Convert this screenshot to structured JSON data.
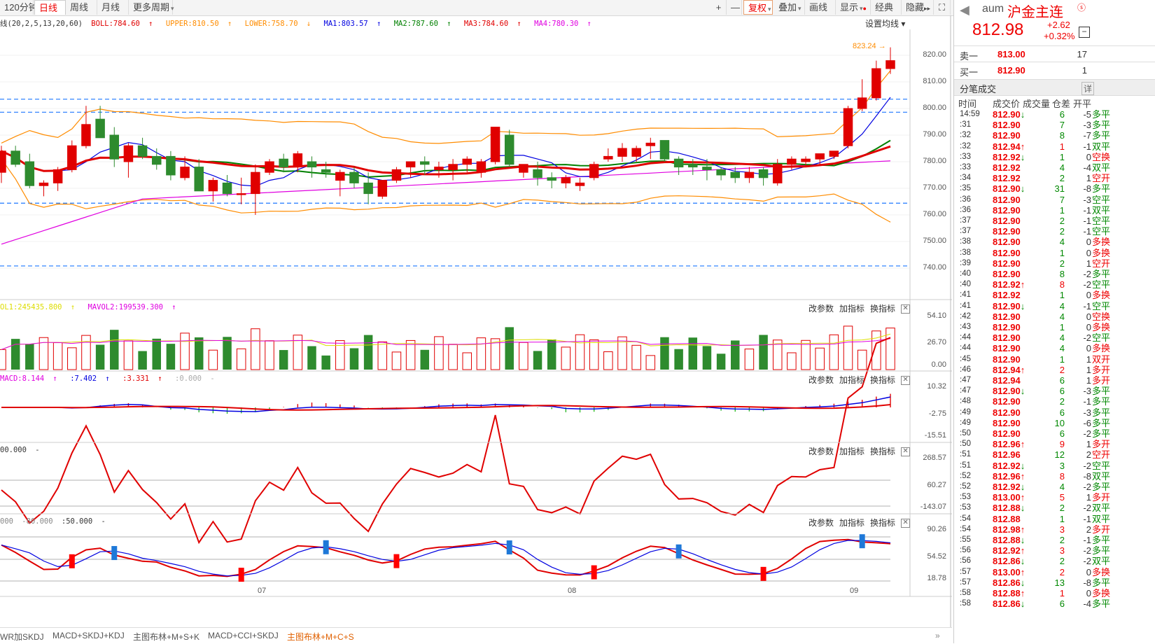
{
  "toolbar": {
    "period_tabs": [
      "120分钟",
      "日线",
      "周线",
      "月线",
      "更多周期"
    ],
    "active_period": "日线",
    "right_buttons": [
      "+",
      "—",
      "复权",
      "叠加",
      "画线",
      "显示",
      "经典",
      "隐藏",
      "⛶"
    ]
  },
  "main_legend": {
    "prefix": "线(20,2,5,13,20,60)",
    "items": [
      {
        "text": "BOLL:784.60",
        "arrow": "↑",
        "color": "#e00000"
      },
      {
        "text": "UPPER:810.50",
        "arrow": "↑",
        "color": "#ff8c00"
      },
      {
        "text": "LOWER:758.70",
        "arrow": "↓",
        "color": "#ff8c00"
      },
      {
        "text": "MA1:803.57",
        "arrow": "↑",
        "color": "#0000e0"
      },
      {
        "text": "MA2:787.60",
        "arrow": "↑",
        "color": "#008000"
      },
      {
        "text": "MA3:784.60",
        "arrow": "↑",
        "color": "#e00000"
      },
      {
        "text": "MA4:780.30",
        "arrow": "↑",
        "color": "#e000e0"
      }
    ],
    "ma_setting": "设置均线 ▾"
  },
  "main_axis": [
    "820.00",
    "810.00",
    "800.00",
    "790.00",
    "780.00",
    "770.00",
    "760.00",
    "750.00",
    "740.00"
  ],
  "peak_label": "823.24",
  "vol_legend": [
    {
      "text": "OL1:245435.800",
      "arrow": "↑",
      "color": "#dddd00"
    },
    {
      "text": "MAVOL2:199539.300",
      "arrow": "↑",
      "color": "#e000e0"
    }
  ],
  "vol_axis": [
    "54.10",
    "26.70",
    "0.00"
  ],
  "macd_legend": [
    {
      "text": "MACD:8.144",
      "arrow": "↑",
      "color": "#e000e0"
    },
    {
      "text": ":7.402",
      "arrow": "↑",
      "color": "#0000e0"
    },
    {
      "text": ":3.331",
      "arrow": "↑",
      "color": "#e00000"
    },
    {
      "text": ":0.000",
      "arrow": "-",
      "color": "#aaaaaa"
    }
  ],
  "macd_axis": [
    "10.32",
    "-2.75",
    "-15.51"
  ],
  "cci_legend": [
    {
      "text": "00.000",
      "arrow": "-",
      "color": "#333333"
    }
  ],
  "cci_axis": [
    "268.57",
    "60.27",
    "-143.07"
  ],
  "kdj_legend": [
    {
      "text": "000",
      "arrow": "",
      "color": "#888888"
    },
    {
      "text": "-80.000",
      "arrow": "",
      "color": "#888888"
    },
    {
      "text": ":50.000",
      "arrow": "-",
      "color": "#333333"
    }
  ],
  "kdj_axis": [
    "90.26",
    "54.52",
    "18.78"
  ],
  "panel_buttons": [
    "改参数",
    "加指标",
    "换指标"
  ],
  "x_labels": [
    "07",
    "08",
    "09"
  ],
  "bottom_tabs": [
    "WR加SKDJ",
    "MACD+SKDJ+KDJ",
    "主图布林+M+S+K",
    "MACD+CCI+SKDJ",
    "主图布林+M+C+S"
  ],
  "active_bottom_tab": "主图布林+M+C+S",
  "quote": {
    "code": "aum",
    "name": "沪金主连",
    "price": "812.98",
    "change": "+2.62",
    "change_pct": "+0.32%",
    "sell1_label": "卖一",
    "sell1_price": "813.00",
    "sell1_vol": "17",
    "buy1_label": "买一",
    "buy1_price": "812.90",
    "buy1_vol": "1"
  },
  "ticks_title": "分笔成交",
  "ticks_detail": "详",
  "ticks_headers": [
    "时间",
    "成交价",
    "成交量",
    "仓差",
    "开平"
  ],
  "ticks": [
    [
      "14:59",
      "812.90",
      "↓",
      "6",
      "-5",
      "多平"
    ],
    [
      ":31",
      "812.90",
      "",
      "7",
      "-3",
      "多平"
    ],
    [
      ":32",
      "812.90",
      "",
      "8",
      "-7",
      "多平"
    ],
    [
      ":32",
      "812.94",
      "↑",
      "1",
      "-1",
      "双平"
    ],
    [
      ":33",
      "812.92",
      "↓",
      "1",
      "0",
      "空换"
    ],
    [
      ":33",
      "812.92",
      "",
      "4",
      "-4",
      "双平"
    ],
    [
      ":34",
      "812.92",
      "",
      "2",
      "1",
      "空开"
    ],
    [
      ":35",
      "812.90",
      "↓",
      "31",
      "-8",
      "多平"
    ],
    [
      ":36",
      "812.90",
      "",
      "7",
      "-3",
      "空平"
    ],
    [
      ":36",
      "812.90",
      "",
      "1",
      "-1",
      "双平"
    ],
    [
      ":37",
      "812.90",
      "",
      "2",
      "-1",
      "空平"
    ],
    [
      ":37",
      "812.90",
      "",
      "2",
      "-1",
      "空平"
    ],
    [
      ":38",
      "812.90",
      "",
      "4",
      "0",
      "多换"
    ],
    [
      ":38",
      "812.90",
      "",
      "1",
      "0",
      "多换"
    ],
    [
      ":39",
      "812.90",
      "",
      "2",
      "1",
      "空开"
    ],
    [
      ":40",
      "812.90",
      "",
      "8",
      "-2",
      "多平"
    ],
    [
      ":40",
      "812.92",
      "↑",
      "8",
      "-2",
      "空平"
    ],
    [
      ":41",
      "812.92",
      "",
      "1",
      "0",
      "多换"
    ],
    [
      ":41",
      "812.90",
      "↓",
      "4",
      "-1",
      "空平"
    ],
    [
      ":42",
      "812.90",
      "",
      "4",
      "0",
      "空换"
    ],
    [
      ":43",
      "812.90",
      "",
      "1",
      "0",
      "多换"
    ],
    [
      ":44",
      "812.90",
      "",
      "4",
      "-2",
      "空平"
    ],
    [
      ":44",
      "812.90",
      "",
      "4",
      "0",
      "多换"
    ],
    [
      ":45",
      "812.90",
      "",
      "1",
      "1",
      "双开"
    ],
    [
      ":46",
      "812.94",
      "↑",
      "2",
      "1",
      "多开"
    ],
    [
      ":47",
      "812.94",
      "",
      "6",
      "1",
      "多开"
    ],
    [
      ":47",
      "812.90",
      "↓",
      "6",
      "-3",
      "多平"
    ],
    [
      ":48",
      "812.90",
      "",
      "2",
      "-1",
      "多平"
    ],
    [
      ":49",
      "812.90",
      "",
      "6",
      "-3",
      "多平"
    ],
    [
      ":49",
      "812.90",
      "",
      "10",
      "-6",
      "多平"
    ],
    [
      ":50",
      "812.90",
      "",
      "6",
      "-2",
      "多平"
    ],
    [
      ":50",
      "812.96",
      "↑",
      "9",
      "1",
      "多开"
    ],
    [
      ":51",
      "812.96",
      "",
      "12",
      "2",
      "空开"
    ],
    [
      ":51",
      "812.92",
      "↓",
      "3",
      "-2",
      "空平"
    ],
    [
      ":52",
      "812.96",
      "↑",
      "8",
      "-8",
      "双平"
    ],
    [
      ":52",
      "812.92",
      "↓",
      "4",
      "-2",
      "多平"
    ],
    [
      ":53",
      "813.00",
      "↑",
      "5",
      "1",
      "多开"
    ],
    [
      ":53",
      "812.88",
      "↓",
      "2",
      "-2",
      "双平"
    ],
    [
      ":54",
      "812.88",
      "",
      "1",
      "-1",
      "双平"
    ],
    [
      ":54",
      "812.98",
      "↑",
      "3",
      "2",
      "多开"
    ],
    [
      ":55",
      "812.88",
      "↓",
      "2",
      "-1",
      "多平"
    ],
    [
      ":56",
      "812.92",
      "↑",
      "3",
      "-2",
      "多平"
    ],
    [
      ":56",
      "812.86",
      "↓",
      "2",
      "-2",
      "双平"
    ],
    [
      ":57",
      "813.00",
      "↑",
      "2",
      "0",
      "多换"
    ],
    [
      ":57",
      "812.86",
      "↓",
      "13",
      "-8",
      "多平"
    ],
    [
      ":58",
      "812.88",
      "↑",
      "1",
      "0",
      "多换"
    ],
    [
      ":58",
      "812.86",
      "↓",
      "6",
      "-4",
      "多平"
    ]
  ],
  "colors": {
    "up": "#e00000",
    "down": "#2e8b2e",
    "boll_band": "#ff8c00",
    "ma1": "#0000e0",
    "ma2": "#008000",
    "ma4": "#e000e0",
    "ref_line": "#1e78ff"
  },
  "chart_data": {
    "type": "candlestick",
    "candles": [
      [
        776,
        786,
        772,
        784
      ],
      [
        784,
        786,
        778,
        779
      ],
      [
        780,
        783,
        770,
        771
      ],
      [
        771,
        773,
        767,
        772
      ],
      [
        772,
        778,
        769,
        777
      ],
      [
        777,
        788,
        776,
        786
      ],
      [
        786,
        801,
        785,
        794
      ],
      [
        796,
        801,
        790,
        789
      ],
      [
        790,
        793,
        778,
        781
      ],
      [
        780,
        787,
        774,
        786
      ],
      [
        786,
        789,
        781,
        782
      ],
      [
        782,
        785,
        777,
        779
      ],
      [
        782,
        784,
        773,
        775
      ],
      [
        774,
        782,
        773,
        778
      ],
      [
        778,
        781,
        769,
        769
      ],
      [
        769,
        774,
        765,
        773
      ],
      [
        772,
        775,
        767,
        768
      ],
      [
        768,
        774,
        764,
        768
      ],
      [
        768,
        779,
        760,
        776
      ],
      [
        776,
        781,
        775,
        780
      ],
      [
        781,
        783,
        776,
        778
      ],
      [
        778,
        784,
        776,
        783
      ],
      [
        780,
        782,
        774,
        778
      ],
      [
        777,
        780,
        774,
        776
      ],
      [
        773,
        777,
        767,
        776
      ],
      [
        776,
        778,
        770,
        772
      ],
      [
        772,
        776,
        764,
        768
      ],
      [
        767,
        773,
        766,
        773
      ],
      [
        773,
        778,
        772,
        777
      ],
      [
        778,
        780,
        774,
        780
      ],
      [
        780,
        782,
        775,
        779
      ],
      [
        777,
        780,
        774,
        778
      ],
      [
        777,
        781,
        773,
        779
      ],
      [
        779,
        782,
        776,
        781
      ],
      [
        776,
        781,
        774,
        780
      ],
      [
        780,
        793,
        779,
        793
      ],
      [
        790,
        792,
        778,
        779
      ],
      [
        776,
        779,
        774,
        779
      ],
      [
        777,
        780,
        771,
        774
      ],
      [
        774,
        776,
        770,
        773
      ],
      [
        772,
        775,
        770,
        774
      ],
      [
        771,
        774,
        769,
        772
      ],
      [
        774,
        780,
        773,
        779
      ],
      [
        781,
        785,
        780,
        782
      ],
      [
        782,
        787,
        780,
        785
      ],
      [
        782,
        786,
        780,
        785
      ],
      [
        786,
        789,
        781,
        787
      ],
      [
        788,
        787,
        780,
        781
      ],
      [
        781,
        782,
        775,
        778
      ],
      [
        779,
        781,
        775,
        778
      ],
      [
        778,
        781,
        773,
        777
      ],
      [
        777,
        778,
        773,
        775
      ],
      [
        776,
        778,
        772,
        774
      ],
      [
        774,
        778,
        772,
        776
      ],
      [
        777,
        778,
        771,
        774
      ],
      [
        772,
        781,
        771,
        779
      ],
      [
        779,
        782,
        777,
        781
      ],
      [
        780,
        782,
        778,
        781
      ],
      [
        781,
        783,
        779,
        783
      ],
      [
        782,
        784,
        781,
        784
      ],
      [
        786,
        801,
        785,
        800
      ],
      [
        800,
        811,
        799,
        804
      ],
      [
        804,
        818,
        803,
        815
      ],
      [
        815,
        823,
        813,
        818
      ]
    ]
  }
}
